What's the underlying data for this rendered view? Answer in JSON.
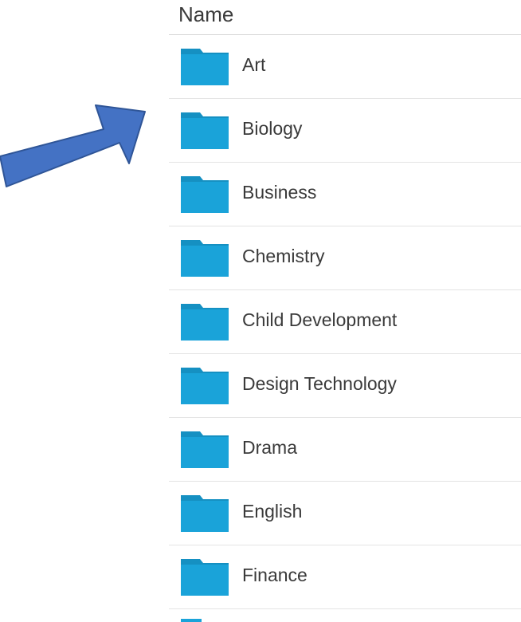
{
  "colors": {
    "folder": "#1aa3d9",
    "folder_shade": "#1590c2",
    "arrow_fill": "#4472c4",
    "arrow_stroke": "#2f5597"
  },
  "list": {
    "header": "Name",
    "items": [
      {
        "label": "Art",
        "icon": "folder-icon"
      },
      {
        "label": "Biology",
        "icon": "folder-icon"
      },
      {
        "label": "Business",
        "icon": "folder-icon"
      },
      {
        "label": "Chemistry",
        "icon": "folder-icon"
      },
      {
        "label": "Child Development",
        "icon": "folder-icon"
      },
      {
        "label": "Design Technology",
        "icon": "folder-icon"
      },
      {
        "label": "Drama",
        "icon": "folder-icon"
      },
      {
        "label": "English",
        "icon": "folder-icon"
      },
      {
        "label": "Finance",
        "icon": "folder-icon"
      }
    ]
  }
}
